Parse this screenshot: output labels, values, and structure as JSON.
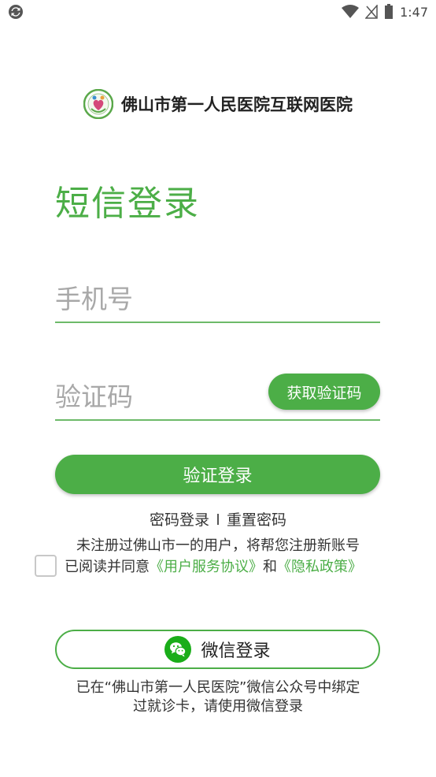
{
  "status_bar": {
    "time": "1:47",
    "icons": [
      "sync-icon",
      "wifi-icon",
      "no-signal-icon",
      "battery-icon"
    ]
  },
  "header": {
    "hospital_name": "佛山市第一人民医院互联网医院"
  },
  "page": {
    "title": "短信登录"
  },
  "form": {
    "phone_placeholder": "手机号",
    "code_placeholder": "验证码",
    "get_code_label": "获取验证码",
    "submit_label": "验证登录"
  },
  "links": {
    "password_login": "密码登录",
    "reset_password": "重置密码"
  },
  "register_hint": "未注册过佛山市一的用户，将帮您注册新账号",
  "agreement": {
    "prefix": "已阅读并同意",
    "user_agreement": "《用户服务协议》",
    "conjunction": "和",
    "privacy_policy": "《隐私政策》",
    "checked": false
  },
  "wechat": {
    "button_label": "微信登录",
    "note_line1": "已在“佛山市第一人民医院”微信公众号中绑定",
    "note_line2": "过就诊卡，请使用微信登录"
  },
  "colors": {
    "accent": "#4cae47",
    "text": "#333333",
    "placeholder": "#a8a8a8"
  }
}
